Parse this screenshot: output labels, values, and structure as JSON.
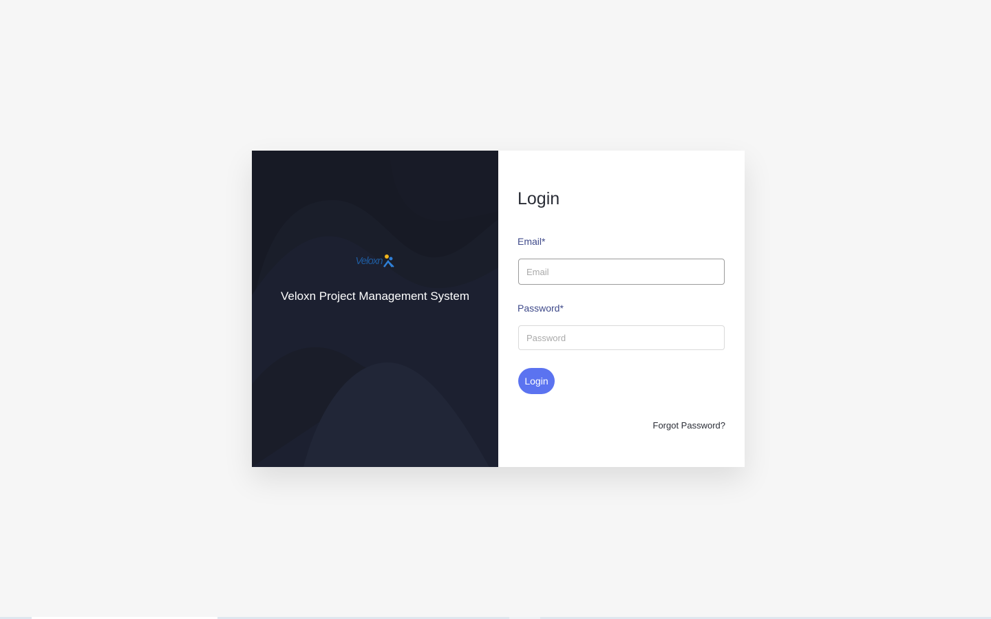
{
  "brand": {
    "logo_text": "Veloxn",
    "tagline": "Veloxn Project Management System"
  },
  "login": {
    "title": "Login",
    "email_label": "Email*",
    "email_placeholder": "Email",
    "email_value": "",
    "password_label": "Password*",
    "password_placeholder": "Password",
    "password_value": "",
    "submit_label": "Login",
    "forgot_label": "Forgot Password?"
  },
  "colors": {
    "page_bg": "#f6f6f6",
    "panel_dark": "#1b1f2c",
    "accent": "#5b73f0",
    "label": "#3f4a8a"
  }
}
